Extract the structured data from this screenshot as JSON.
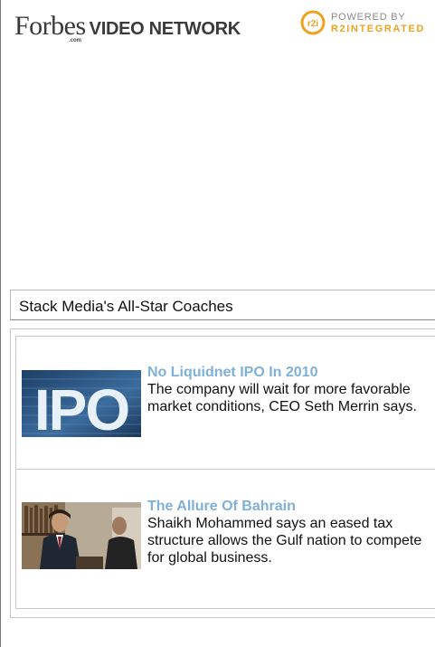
{
  "header": {
    "brand_forbes": "Forbes",
    "brand_dotcom": ".com",
    "brand_network": "VIDEO NETWORK",
    "powered_by": "POWERED BY",
    "powered_name": "R2INTEGRATED",
    "logo_text": "r2i"
  },
  "player": {
    "title": "Stack Media's All-Star Coaches"
  },
  "playlist": {
    "items": [
      {
        "thumb_text": "IPO",
        "title": "No Liquidnet IPO In 2010",
        "description": "The company will wait for more favorable market conditions, CEO Seth Merrin says."
      },
      {
        "thumb_text": "",
        "title": "The Allure Of Bahrain",
        "description": "Shaikh Mohammed says an eased tax structure allows the Gulf nation to compete for global business."
      }
    ]
  },
  "colors": {
    "link": "#7fb1d8",
    "accent_orange": "#f0a11e",
    "border": "#c8c8c8"
  }
}
